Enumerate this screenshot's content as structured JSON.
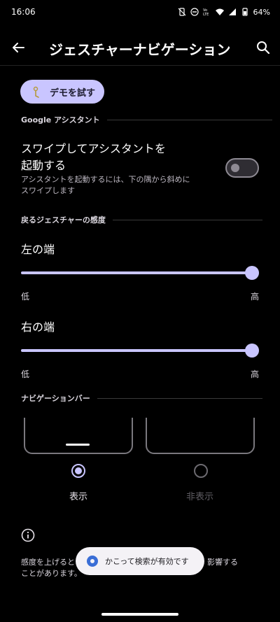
{
  "status": {
    "time": "16:06",
    "battery": "64%",
    "icons": [
      "vibrate-off-icon",
      "dnd-icon",
      "volte-icon",
      "wifi-icon",
      "signal-icon",
      "battery-icon"
    ],
    "volte_label": "Vo\nLTE"
  },
  "appbar": {
    "title": "ジェスチャーナビゲーション"
  },
  "demo": {
    "label": "デモを試す"
  },
  "assistant": {
    "section": "Google アシスタント",
    "title_line1": "スワイプしてアシスタントを",
    "title_line2": "起動する",
    "subtitle_line1": "アシスタントを起動するには、下の隅から斜めに",
    "subtitle_line2": "スワイプします",
    "enabled": false
  },
  "sensitivity": {
    "section": "戻るジェスチャーの感度",
    "left": {
      "label": "左の端",
      "value": 1.0,
      "low": "低",
      "high": "高"
    },
    "right": {
      "label": "右の端",
      "value": 1.0,
      "low": "低",
      "high": "高"
    }
  },
  "navbar": {
    "section": "ナビゲーションバー",
    "show": {
      "label": "表示",
      "selected": true
    },
    "hide": {
      "label": "非表示",
      "selected": false
    }
  },
  "info": {
    "line1_start": "感度を上げると",
    "line1_end": "影響する",
    "line2": "ことがあります。"
  },
  "toast": {
    "text": "かこって検索が有効です"
  },
  "colors": {
    "accent": "#c9c5ff",
    "background": "#000000",
    "disabled_text": "#5f5d63"
  }
}
